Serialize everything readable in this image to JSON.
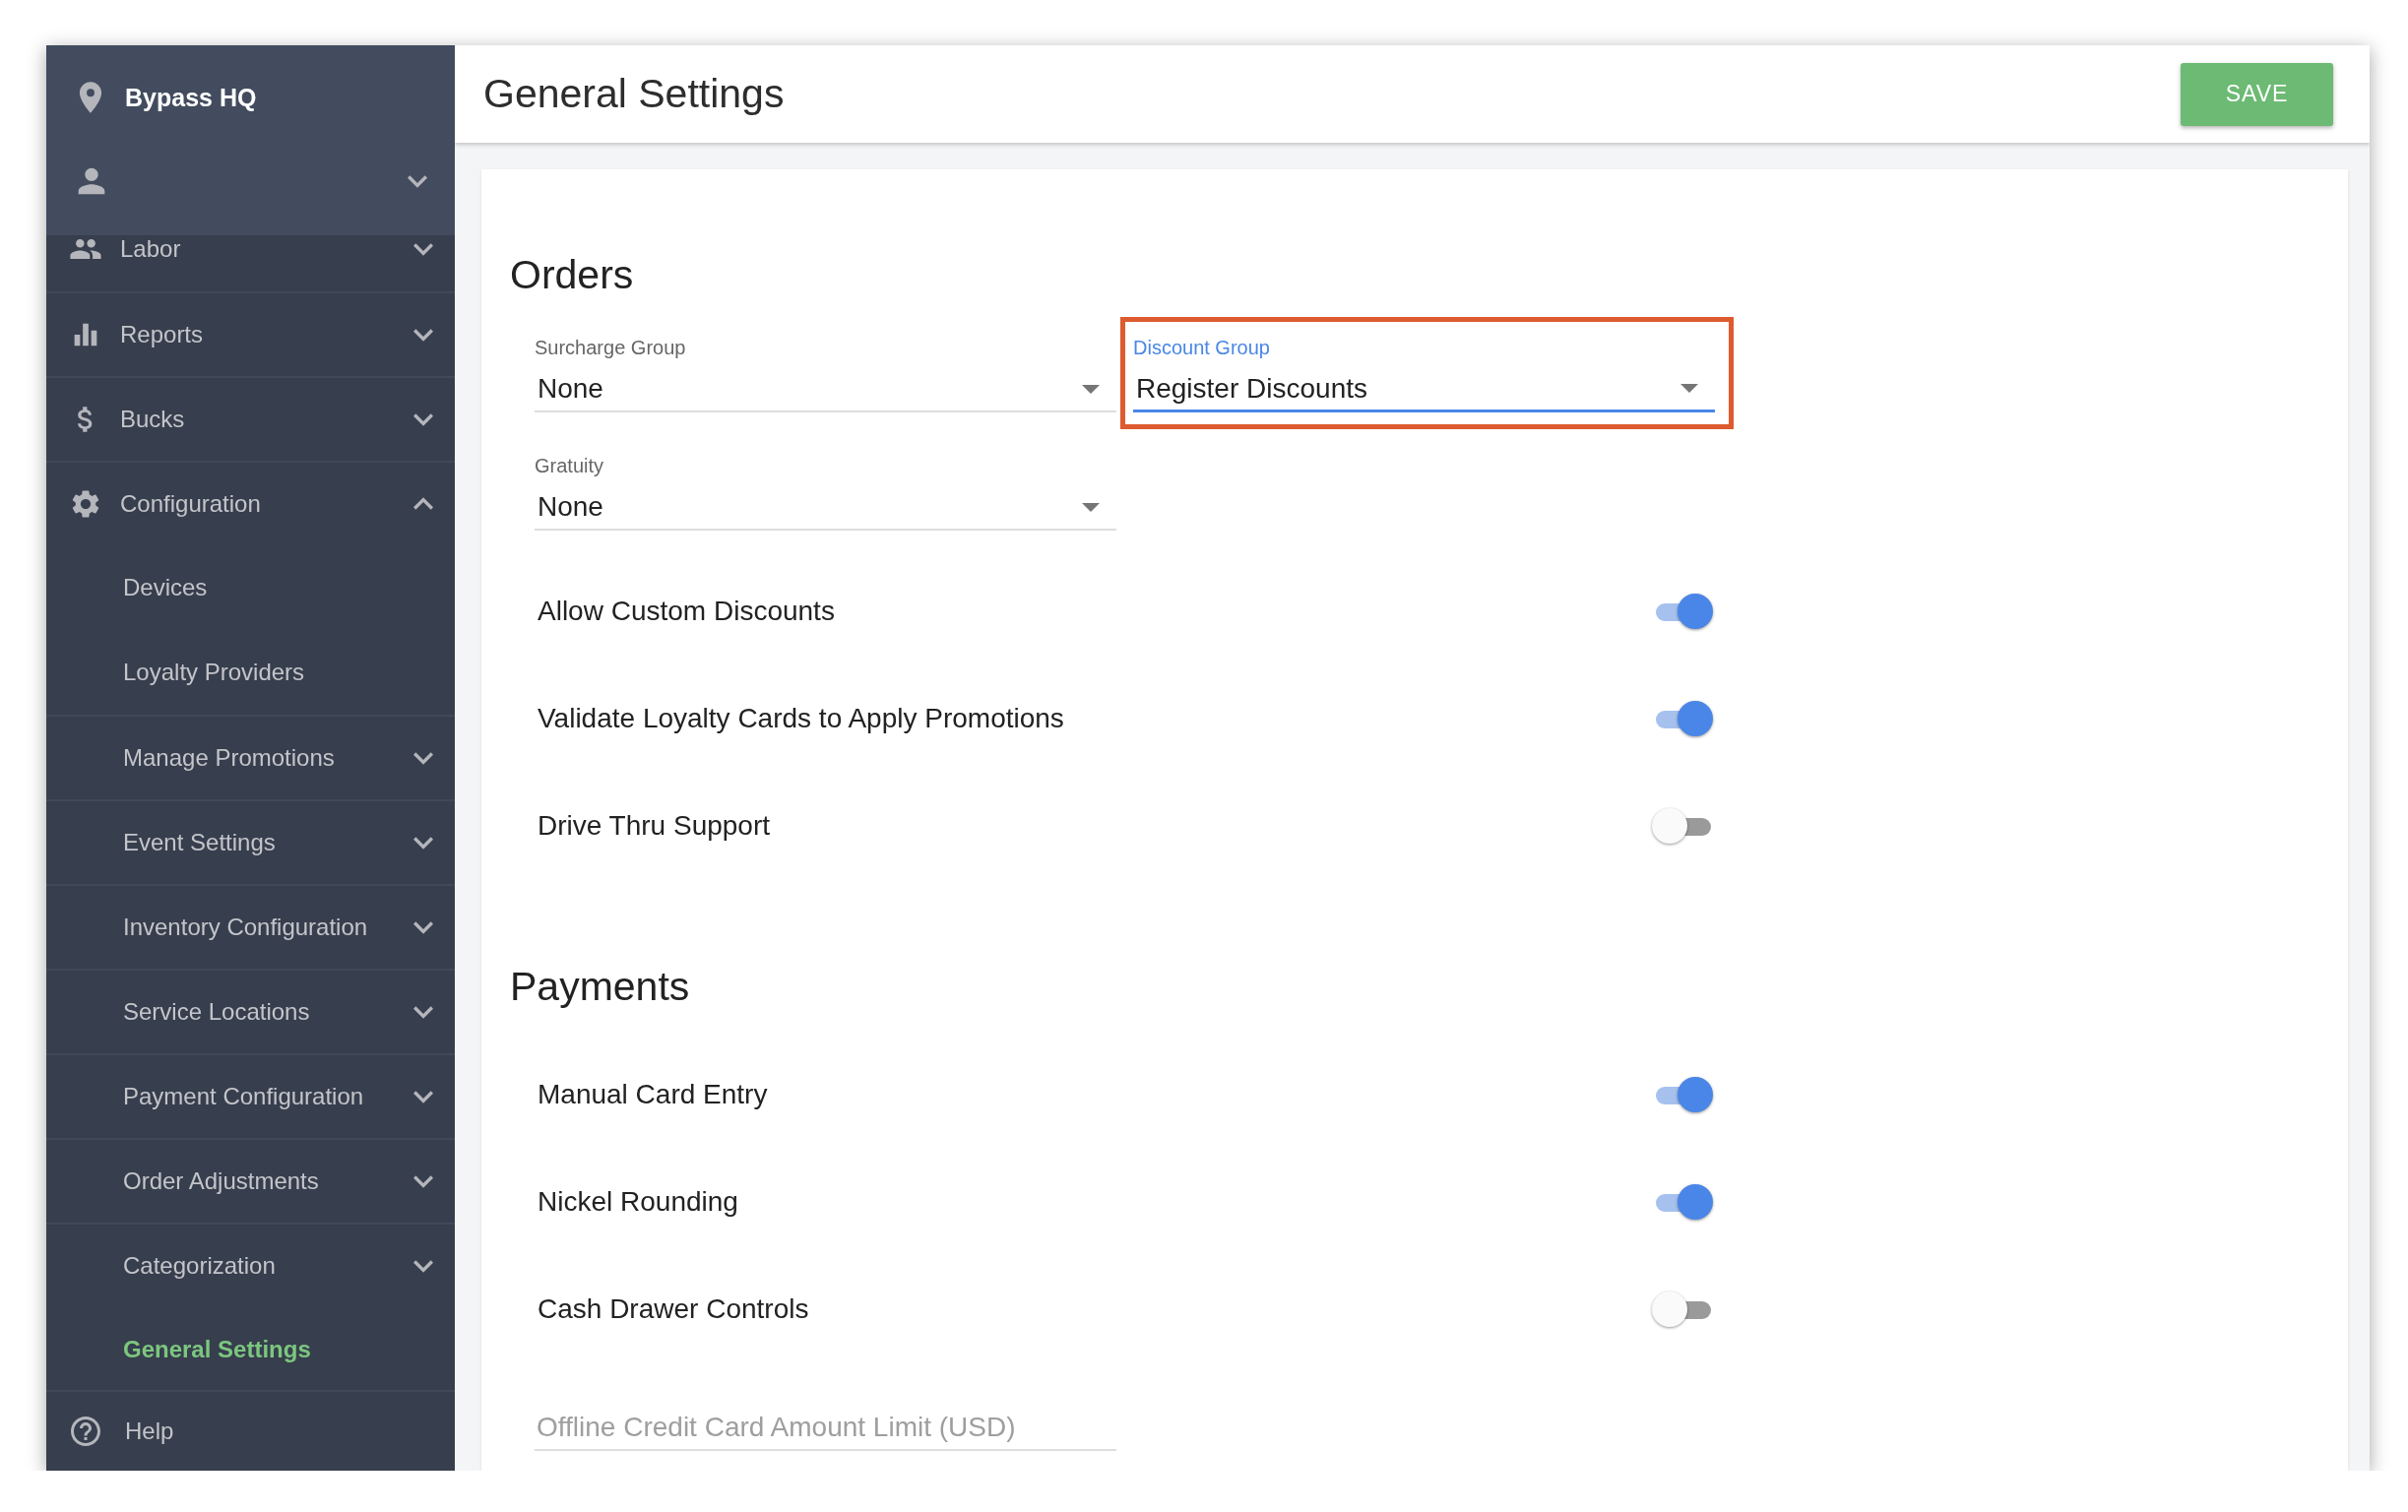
{
  "sidebar": {
    "location": "Bypass HQ",
    "user": {
      "expanded": false
    },
    "items": [
      {
        "label": "Labor",
        "expanded": false,
        "selected": false
      },
      {
        "label": "Reports",
        "expanded": false,
        "selected": false
      },
      {
        "label": "Bucks",
        "expanded": false,
        "selected": false
      },
      {
        "label": "Configuration",
        "expanded": true,
        "selected": false,
        "children": [
          {
            "label": "Devices",
            "selected": false
          },
          {
            "label": "Loyalty Providers",
            "selected": false
          },
          {
            "label": "Manage Promotions",
            "expanded": false,
            "selected": false
          },
          {
            "label": "Event Settings",
            "expanded": false,
            "selected": false
          },
          {
            "label": "Inventory Configuration",
            "expanded": false,
            "selected": false
          },
          {
            "label": "Service Locations",
            "expanded": false,
            "selected": false
          },
          {
            "label": "Payment Configuration",
            "expanded": false,
            "selected": false
          },
          {
            "label": "Order Adjustments",
            "expanded": false,
            "selected": false
          },
          {
            "label": "Categorization",
            "expanded": false,
            "selected": false
          },
          {
            "label": "General Settings",
            "selected": true
          }
        ]
      }
    ],
    "help": {
      "label": "Help"
    }
  },
  "header": {
    "title": "General Settings",
    "save_button": "SAVE"
  },
  "sections": [
    {
      "title": "Orders",
      "items": [
        {
          "kind": "select",
          "label": "Surcharge Group",
          "value": "None",
          "focused": false,
          "highlighted": false
        },
        {
          "kind": "select",
          "label": "Discount Group",
          "value": "Register Discounts",
          "focused": true,
          "highlighted": true
        },
        {
          "kind": "select",
          "label": "Gratuity",
          "value": "None",
          "focused": false,
          "highlighted": false
        },
        {
          "kind": "toggle",
          "label": "Allow Custom Discounts",
          "on": true
        },
        {
          "kind": "toggle",
          "label": "Validate Loyalty Cards to Apply Promotions",
          "on": true
        },
        {
          "kind": "toggle",
          "label": "Drive Thru Support",
          "on": false
        }
      ]
    },
    {
      "title": "Payments",
      "items": [
        {
          "kind": "toggle",
          "label": "Manual Card Entry",
          "on": true
        },
        {
          "kind": "toggle",
          "label": "Nickel Rounding",
          "on": true
        },
        {
          "kind": "toggle",
          "label": "Cash Drawer Controls",
          "on": false
        },
        {
          "kind": "input",
          "placeholder": "Offline Credit Card Amount Limit (USD)"
        }
      ]
    }
  ]
}
